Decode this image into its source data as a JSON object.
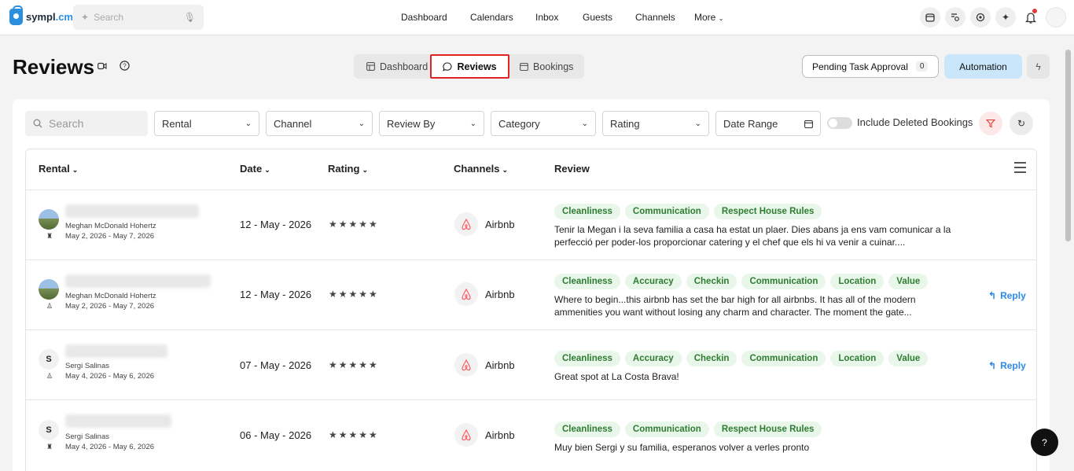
{
  "brand": {
    "name_a": "sympl",
    "name_b": ".cm"
  },
  "top_search": {
    "placeholder": "Search"
  },
  "nav": {
    "items": [
      {
        "label": "Dashboard"
      },
      {
        "label": "Calendars"
      },
      {
        "label": "Inbox"
      },
      {
        "label": "Guests"
      },
      {
        "label": "Channels"
      },
      {
        "label": "More"
      }
    ]
  },
  "top_icons": [
    "calendar-icon",
    "search-list-icon",
    "settings-badge-icon",
    "sparkle-icon",
    "bell-icon",
    "avatar"
  ],
  "page": {
    "title": "Reviews"
  },
  "tabs": [
    {
      "label": "Dashboard",
      "icon": "layout-icon",
      "active": false
    },
    {
      "label": "Reviews",
      "icon": "chat-icon",
      "active": true
    },
    {
      "label": "Bookings",
      "icon": "calendar-icon",
      "active": false
    }
  ],
  "actions": {
    "pending_label": "Pending Task Approval",
    "pending_count": "0",
    "automation_label": "Automation"
  },
  "filters": {
    "search_placeholder": "Search",
    "rental": "Rental",
    "channel": "Channel",
    "review_by": "Review By",
    "category": "Category",
    "rating": "Rating",
    "date_range": "Date Range",
    "include_deleted": "Include Deleted Bookings"
  },
  "columns": {
    "rental": "Rental",
    "date": "Date",
    "rating": "Rating",
    "channels": "Channels",
    "review": "Review"
  },
  "rows": [
    {
      "avatar": "",
      "host": "Meghan McDonald Hohertz",
      "dates": "May 2, 2026 - May 7, 2026",
      "date": "12 - May - 2026",
      "stars": "★★★★★",
      "channel": "Airbnb",
      "tags": [
        "Cleanliness",
        "Communication",
        "Respect House Rules"
      ],
      "review": "Tenir la Megan i la seva familia a casa ha estat un plaer. Dies abans ja ens vam comunicar a la perfecció per poder-los proporcionar catering y el chef que els hi va venir a cuinar....",
      "reply": ""
    },
    {
      "avatar": "",
      "host": "Meghan McDonald Hohertz",
      "dates": "May 2, 2026 - May 7, 2026",
      "date": "12 - May - 2026",
      "stars": "★★★★★",
      "channel": "Airbnb",
      "tags": [
        "Cleanliness",
        "Accuracy",
        "Checkin",
        "Communication",
        "Location",
        "Value"
      ],
      "review": "Where to begin...this airbnb has set the bar high for all airbnbs. It has all of the modern ammenities you want without losing any charm and character. The moment the gate...",
      "reply": "Reply"
    },
    {
      "avatar": "S",
      "host": "Sergi Salinas",
      "dates": "May 4, 2026 - May 6, 2026",
      "date": "07 - May - 2026",
      "stars": "★★★★★",
      "channel": "Airbnb",
      "tags": [
        "Cleanliness",
        "Accuracy",
        "Checkin",
        "Communication",
        "Location",
        "Value"
      ],
      "review": "Great spot at La Costa Brava!",
      "reply": "Reply"
    },
    {
      "avatar": "S",
      "host": "Sergi Salinas",
      "dates": "May 4, 2026 - May 6, 2026",
      "date": "06 - May - 2026",
      "stars": "★★★★★",
      "channel": "Airbnb",
      "tags": [
        "Cleanliness",
        "Communication",
        "Respect House Rules"
      ],
      "review": "Muy bien Sergi y su familia, esperanos volver a verles pronto",
      "reply": ""
    }
  ],
  "help": {
    "label": "?"
  },
  "colors": {
    "accent": "#2d89e5",
    "tag_text": "#2e7d32",
    "tag_bg": "#e9f6ea",
    "active_outline": "#e02424",
    "airbnb": "#ff5a5f"
  }
}
